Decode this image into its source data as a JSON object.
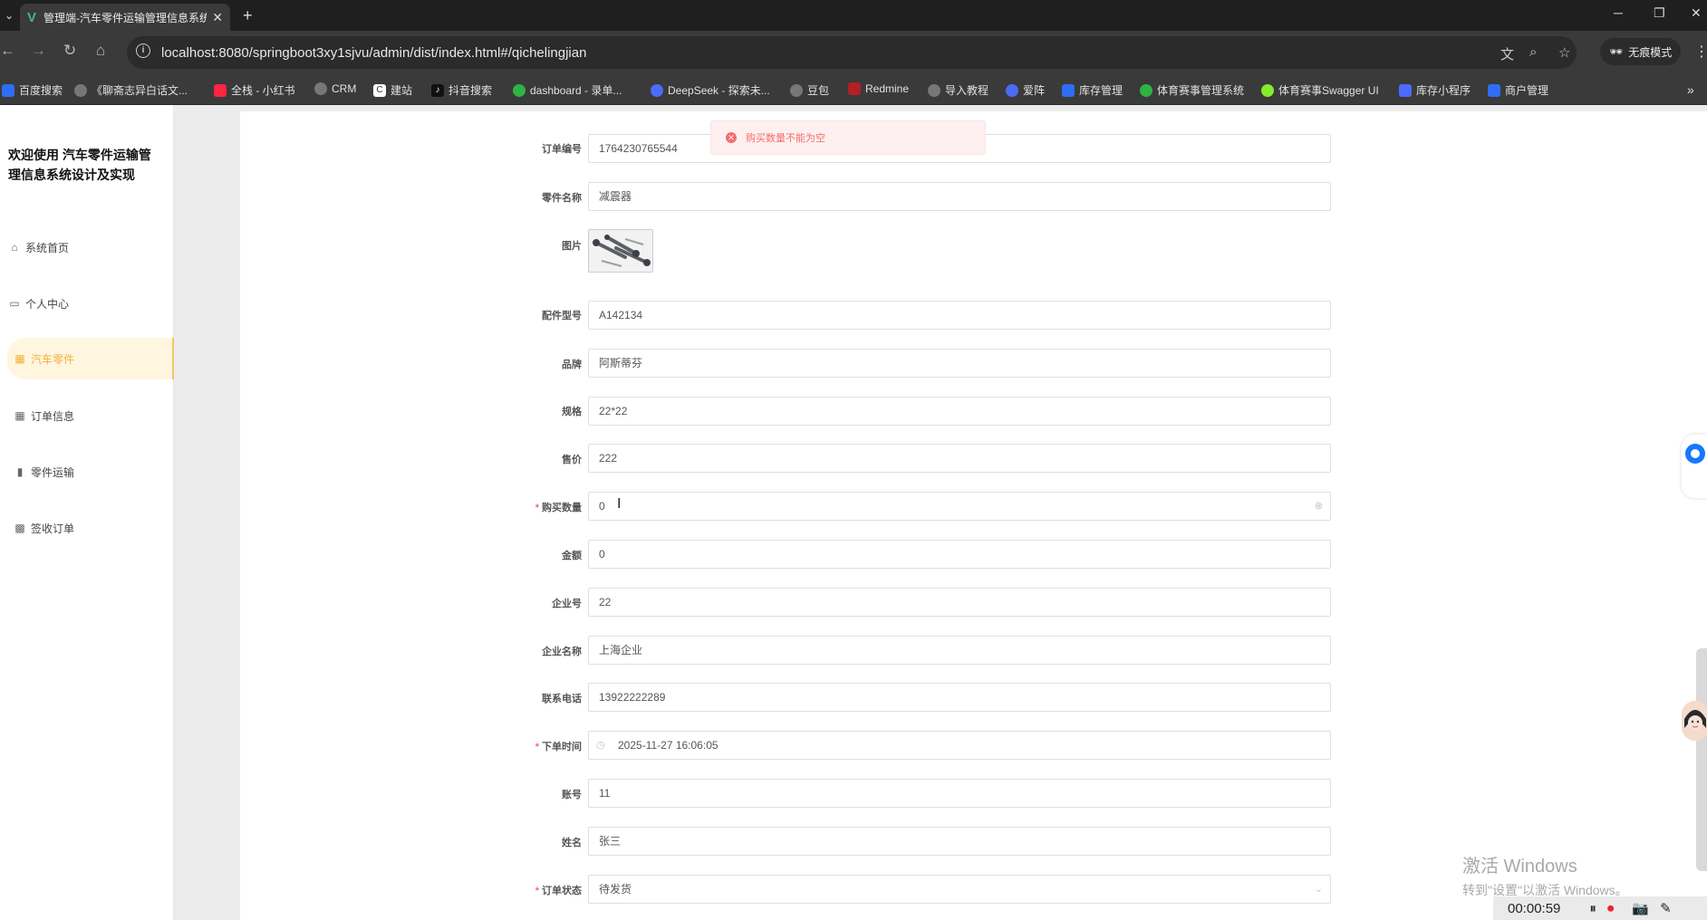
{
  "browser": {
    "tab_title": "管理端-汽车零件运输管理信息系统",
    "url_host": "localhost",
    "url_rest": ":8080/springboot3xy1sjvu/admin/dist/index.html#/qichelingjian",
    "incognito_label": "无痕模式",
    "bookmarks": [
      {
        "label": "百度搜索",
        "color": "#2f6df6"
      },
      {
        "label": "《聊斋志异白话文...",
        "color": "#777"
      },
      {
        "label": "全栈 - 小红书",
        "color": "#ff2442"
      },
      {
        "label": "CRM",
        "color": "#777"
      },
      {
        "label": "建站",
        "color": "#ffffff"
      },
      {
        "label": "抖音搜索",
        "color": "#111111"
      },
      {
        "label": "dashboard - 录单...",
        "color": "#2fb344"
      },
      {
        "label": "DeepSeek - 探索未...",
        "color": "#4d6bfe"
      },
      {
        "label": "豆包",
        "color": "#777"
      },
      {
        "label": "Redmine",
        "color": "#b32024"
      },
      {
        "label": "导入教程",
        "color": "#777"
      },
      {
        "label": "爱阵",
        "color": "#4a6cf7"
      },
      {
        "label": "库存管理",
        "color": "#2f6df6"
      },
      {
        "label": "体育赛事管理系统",
        "color": "#2fb344"
      },
      {
        "label": "体育赛事Swagger UI",
        "color": "#85ea2d"
      },
      {
        "label": "库存小程序",
        "color": "#4d6bfe"
      },
      {
        "label": "商户管理",
        "color": "#2f6df6"
      }
    ]
  },
  "sidebar": {
    "title": "欢迎使用 汽车零件运输管理信息系统设计及实现",
    "items": [
      {
        "label": "系统首页",
        "icon": "home-icon"
      },
      {
        "label": "个人中心",
        "icon": "id-card-icon"
      },
      {
        "label": "汽车零件",
        "icon": "grid-icon"
      },
      {
        "label": "订单信息",
        "icon": "grid-icon"
      },
      {
        "label": "零件运输",
        "icon": "bar-chart-icon"
      },
      {
        "label": "签收订单",
        "icon": "grid9-icon"
      }
    ],
    "active_index": 2
  },
  "toast": {
    "message": "购买数量不能为空"
  },
  "form": {
    "fields": [
      {
        "label": "订单编号",
        "value": "1764230765544"
      },
      {
        "label": "零件名称",
        "value": "减震器"
      },
      {
        "label": "图片"
      },
      {
        "label": "配件型号",
        "value": "A142134"
      },
      {
        "label": "品牌",
        "value": "阿斯蒂芬"
      },
      {
        "label": "规格",
        "value": "22*22"
      },
      {
        "label": "售价",
        "value": "222"
      },
      {
        "label": "购买数量",
        "value": "0"
      },
      {
        "label": "金额",
        "value": "0"
      },
      {
        "label": "企业号",
        "value": "22"
      },
      {
        "label": "企业名称",
        "value": "上海企业"
      },
      {
        "label": "联系电话",
        "value": "13922222289"
      },
      {
        "label": "下单时间",
        "value": "2025-11-27 16:06:05"
      },
      {
        "label": "账号",
        "value": "11"
      },
      {
        "label": "姓名",
        "value": "张三"
      },
      {
        "label": "订单状态",
        "value": "待发货"
      }
    ]
  },
  "overlay": {
    "activate_line1": "激活 Windows",
    "activate_line2": "转到\"设置\"以激活 Windows。",
    "recording_time": "00:00:59"
  }
}
